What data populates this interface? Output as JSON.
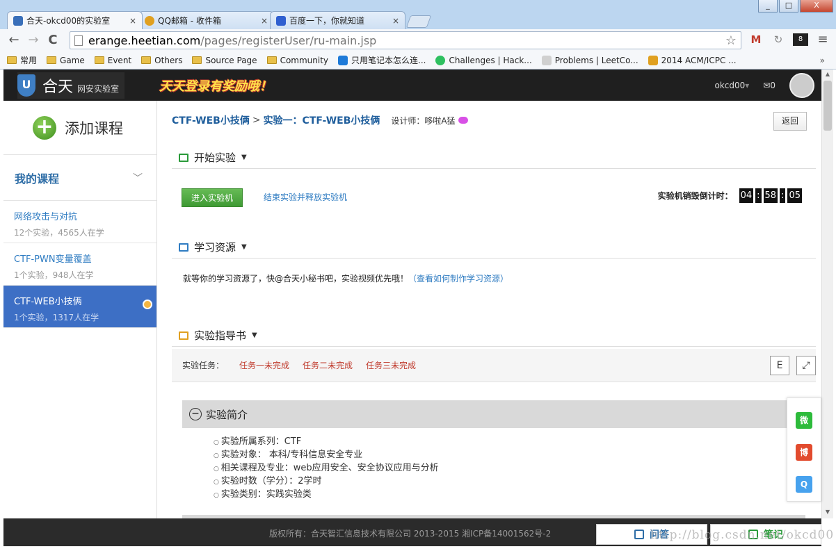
{
  "window": {
    "minimize": "_",
    "maximize": "□",
    "close": "X"
  },
  "tabs": [
    {
      "title": "合天-okcd00的实验室",
      "close": "×",
      "color": "#3a6fb9"
    },
    {
      "title": "QQ邮箱 - 收件箱",
      "close": "×",
      "color": "#e0a020"
    },
    {
      "title": "百度一下，你就知道",
      "close": "×",
      "color": "#2f5fd0"
    }
  ],
  "toolbar": {
    "back": "←",
    "forward": "→",
    "reload": "C"
  },
  "address": {
    "domain": "erange.heetian.com",
    "path": "/pages/registerUser/ru-main.jsp",
    "star": "☆"
  },
  "extensions": {
    "gmail": "M",
    "ext2": "↻",
    "ext3": "8",
    "menu": "≡"
  },
  "bookmarks": [
    {
      "label": "常用",
      "type": "folder"
    },
    {
      "label": "Game",
      "type": "folder"
    },
    {
      "label": "Event",
      "type": "folder"
    },
    {
      "label": "Others",
      "type": "folder"
    },
    {
      "label": "Source Page",
      "type": "folder"
    },
    {
      "label": "Community",
      "type": "folder"
    },
    {
      "label": "只用笔记本怎么连...",
      "type": "link",
      "color": "#1e7ad8"
    },
    {
      "label": "Challenges | Hack...",
      "type": "link",
      "color": "#2ec060"
    },
    {
      "label": "Problems | LeetCo...",
      "type": "link",
      "color": "#d0d0d0"
    },
    {
      "label": "2014 ACM/ICPC ...",
      "type": "link",
      "color": "#e0a020"
    }
  ],
  "bookmarks_more": "»",
  "site": {
    "logo_mark": "U",
    "brand": "合天",
    "brand_sub": "网安实验室",
    "promo": "天天登录有奖励哦！",
    "user": "okcd00",
    "user_caret": "▾",
    "mail": "✉0"
  },
  "sidebar": {
    "add_course": "添加课程",
    "add_icon": "+",
    "my_courses": "我的课程",
    "chevron": "﹀",
    "courses": [
      {
        "name": "网络攻击与对抗",
        "meta": "12个实验，4565人在学"
      },
      {
        "name": "CTF-PWN变量覆盖",
        "meta": "1个实验，948人在学"
      },
      {
        "name": "CTF-WEB小技俩",
        "meta": "1个实验，1317人在学"
      }
    ]
  },
  "main": {
    "crumb_course": "CTF-WEB小技俩",
    "crumb_sep": ">",
    "crumb_lab": "实验一：CTF-WEB小技俩",
    "designer": "设计师：哆啦A猛",
    "back": "返回",
    "start_section": "开始实验",
    "caret": "▼",
    "enter_btn": "进入实验机",
    "end_link": "结束实验并释放实验机",
    "timer_label": "实验机销毁倒计时：",
    "timer_h": "04",
    "timer_m": "58",
    "timer_s": "05",
    "timer_sep": ":",
    "res_section": "学习资源",
    "res_text": "就等你的学习资源了，快@合天小秘书吧，实验视频优先哦！",
    "res_link": "（查看如何制作学习资源）",
    "guide_section": "实验指导书",
    "task_label": "实验任务：",
    "tasks": [
      "任务一未完成",
      "任务二未完成",
      "任务三未完成"
    ],
    "tool_toc": "E",
    "tool_full": "⤢",
    "intro_title": "实验简介",
    "intro_icon": "−",
    "intro_items": [
      "实验所属系列：CTF",
      "实验对象： 本科/专科信息安全专业",
      "相关课程及专业：web应用安全、安全协议应用与分析",
      "实验时数（学分）：2学时",
      "实验类别：实践实验类"
    ]
  },
  "social": {
    "wechat": "微",
    "weibo": "博",
    "qq": "Q"
  },
  "footer": {
    "copyright": "版权所有：合天智汇信息技术有限公司 2013-2015 湘ICP备14001562号-2",
    "qa": "问答",
    "notes": "笔记"
  },
  "watermark": "http://blog.csdn.net/okcd00"
}
